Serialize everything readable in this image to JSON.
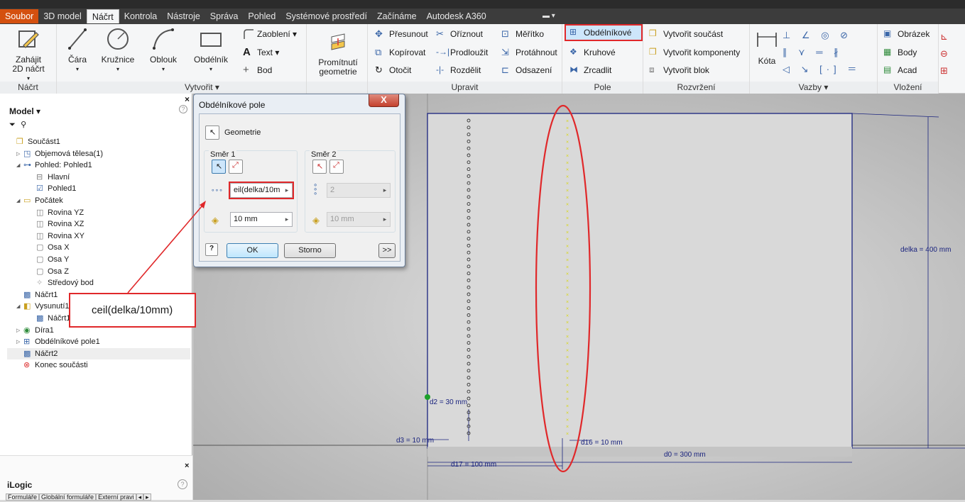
{
  "menubar": {
    "tabs": [
      {
        "label": "Soubor",
        "state": "orange"
      },
      {
        "label": "3D model",
        "state": ""
      },
      {
        "label": "Náčrt",
        "state": "active"
      },
      {
        "label": "Kontrola",
        "state": ""
      },
      {
        "label": "Nástroje",
        "state": ""
      },
      {
        "label": "Správa",
        "state": ""
      },
      {
        "label": "Pohled",
        "state": ""
      },
      {
        "label": "Systémové prostředí",
        "state": ""
      },
      {
        "label": "Začínáme",
        "state": ""
      },
      {
        "label": "Autodesk A360",
        "state": ""
      }
    ]
  },
  "ribbon": {
    "nacrt": {
      "title": "Náčrt",
      "start_label_1": "Zahájit",
      "start_label_2": "2D náčrt"
    },
    "vytvorit": {
      "title": "Vytvořit ▾",
      "cara": "Čára",
      "kruznice": "Kružnice",
      "oblouk": "Oblouk",
      "obdelnik": "Obdélník",
      "zaobleni": "Zaoblení ▾",
      "text": "Text ▾",
      "bod": "Bod"
    },
    "promitnuti": {
      "label_1": "Promítnutí",
      "label_2": "geometrie"
    },
    "upravit": {
      "title": "Upravit",
      "presunout": "Přesunout",
      "oriznout": "Oříznout",
      "meritko": "Měřítko",
      "kopirovat": "Kopírovat",
      "prodlouzit": "Prodloužit",
      "protahnout": "Protáhnout",
      "otocit": "Otočit",
      "rozdelit": "Rozdělit",
      "odsazeni": "Odsazení"
    },
    "pole": {
      "title": "Pole",
      "obdelnikove": "Obdélníkové",
      "kruhove": "Kruhové",
      "zrcadlit": "Zrcadlit"
    },
    "rozvrzeni": {
      "title": "Rozvržení",
      "soucast": "Vytvořit součást",
      "komponenty": "Vytvořit komponenty",
      "blok": "Vytvořit blok"
    },
    "vazby": {
      "title": "Vazby ▾",
      "kota": "Kóta"
    },
    "vlozeni": {
      "title": "Vložení",
      "obrazek": "Obrázek",
      "body": "Body",
      "acad": "Acad"
    }
  },
  "browser": {
    "header": "Model ▾",
    "tree": [
      {
        "label": "Součást1",
        "indent": 0,
        "exp": ""
      },
      {
        "label": "Objemová tělesa(1)",
        "indent": 1,
        "exp": "▷"
      },
      {
        "label": "Pohled: Pohled1",
        "indent": 1,
        "exp": "◢"
      },
      {
        "label": "Hlavní",
        "indent": 2,
        "exp": ""
      },
      {
        "label": "Pohled1",
        "indent": 2,
        "exp": ""
      },
      {
        "label": "Počátek",
        "indent": 1,
        "exp": "◢"
      },
      {
        "label": "Rovina YZ",
        "indent": 2,
        "exp": ""
      },
      {
        "label": "Rovina XZ",
        "indent": 2,
        "exp": ""
      },
      {
        "label": "Rovina XY",
        "indent": 2,
        "exp": ""
      },
      {
        "label": "Osa X",
        "indent": 2,
        "exp": ""
      },
      {
        "label": "Osa Y",
        "indent": 2,
        "exp": ""
      },
      {
        "label": "Osa Z",
        "indent": 2,
        "exp": ""
      },
      {
        "label": "Středový bod",
        "indent": 2,
        "exp": ""
      },
      {
        "label": "Náčrt1",
        "indent": 1,
        "exp": ""
      },
      {
        "label": "Vysunutí1",
        "indent": 1,
        "exp": "◢"
      },
      {
        "label": "Náčrt1",
        "indent": 2,
        "exp": ""
      },
      {
        "label": "Díra1",
        "indent": 1,
        "exp": "▷"
      },
      {
        "label": "Obdélníkové pole1",
        "indent": 1,
        "exp": "▷"
      },
      {
        "label": "Náčrt2",
        "indent": 1,
        "exp": "",
        "selected": true
      },
      {
        "label": "Konec součásti",
        "indent": 1,
        "exp": ""
      }
    ]
  },
  "ilogic": {
    "title": "iLogic",
    "tabs": [
      "Formuláře",
      "Globální formuláře",
      "Externí pravi",
      "◂",
      "▸"
    ]
  },
  "dialog": {
    "title": "Obdélníkové pole",
    "close": "X",
    "geometry_label": "Geometrie",
    "dir1": {
      "label": "Směr 1",
      "count_value": "eil(delka/10m",
      "spacing_value": "10 mm"
    },
    "dir2": {
      "label": "Směr 2",
      "count_value": "2",
      "spacing_value": "10 mm"
    },
    "ok": "OK",
    "cancel": "Storno",
    "more": ">>",
    "help": "?"
  },
  "annotation": {
    "text": "ceil(delka/10mm)"
  },
  "canvas": {
    "dims": {
      "d2": "d2 = 30 mm",
      "d3": "d3 = 10 mm",
      "d16": "d16 = 10 mm",
      "d0": "d0 = 300 mm",
      "d17": "d17 = 100 mm",
      "delka": "delka = 400 mm"
    }
  }
}
